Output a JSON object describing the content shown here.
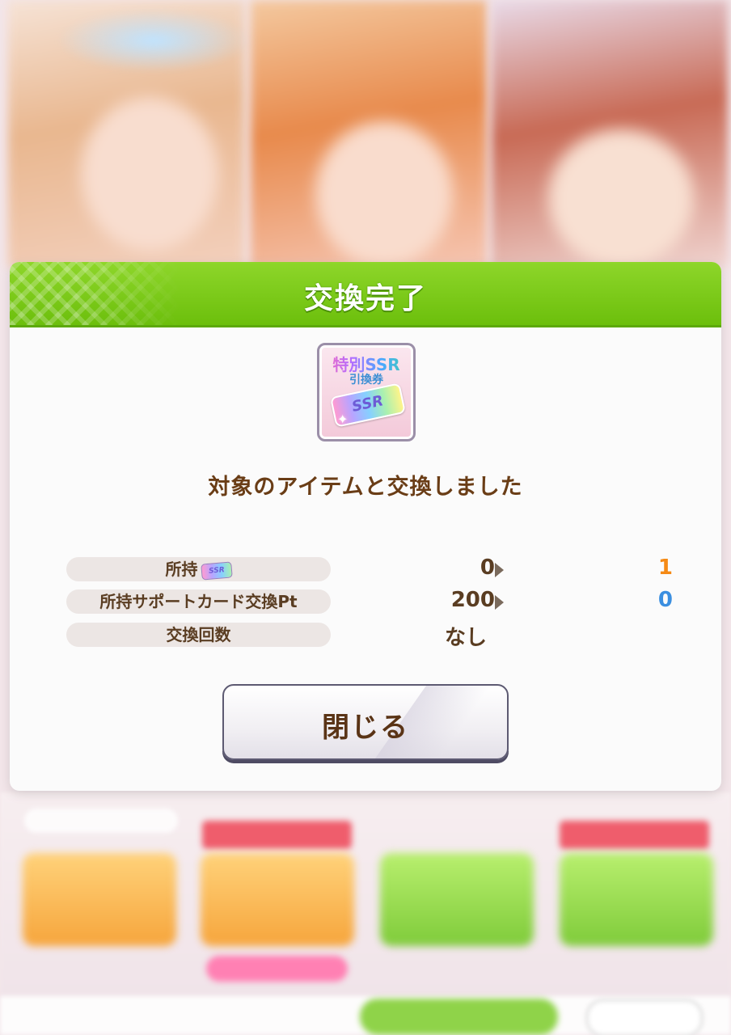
{
  "dialog": {
    "title": "交換完了",
    "item": {
      "icon_name": "special-ssr-exchange-ticket-icon",
      "label_line1": "特別SSR",
      "label_line2": "引換券",
      "ticket_text": "SSR"
    },
    "message": "対象のアイテムと交換しました",
    "rows": [
      {
        "label": "所持",
        "label_icon": "ssr-ticket-icon",
        "mini_ticket_text": "SSR",
        "before": "0",
        "after": "1"
      },
      {
        "label": "所持サポートカード交換Pt",
        "before": "200",
        "after": "0"
      },
      {
        "label": "交換回数",
        "value": "なし"
      }
    ],
    "close_label": "閉じる"
  },
  "colors": {
    "header_green": "#7dcc1a",
    "text_brown": "#6a3d16",
    "after_orange": "#f58a15",
    "after_blue": "#3b8fe0"
  }
}
